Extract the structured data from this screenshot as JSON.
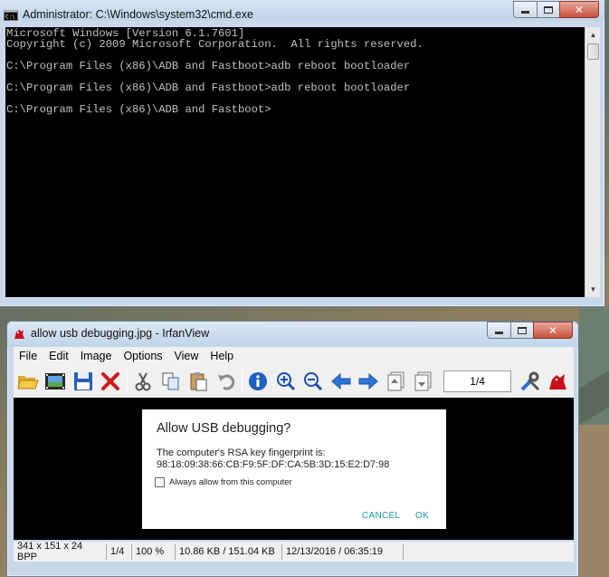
{
  "cmd": {
    "title": "Administrator: C:\\Windows\\system32\\cmd.exe",
    "lines": [
      "Microsoft Windows [Version 6.1.7601]",
      "Copyright (c) 2009 Microsoft Corporation.  All rights reserved.",
      "",
      "C:\\Program Files (x86)\\ADB and Fastboot>adb reboot bootloader",
      "",
      "C:\\Program Files (x86)\\ADB and Fastboot>adb reboot bootloader",
      "",
      "C:\\Program Files (x86)\\ADB and Fastboot>"
    ]
  },
  "irfanview": {
    "title": "allow usb debugging.jpg - IrfanView",
    "menu": [
      "File",
      "Edit",
      "Image",
      "Options",
      "View",
      "Help"
    ],
    "page_indicator": "1/4",
    "toolbar_icons": [
      "open-folder-icon",
      "thumbnails-icon",
      "save-icon",
      "delete-icon",
      "cut-icon",
      "copy-icon",
      "paste-icon",
      "undo-icon",
      "info-icon",
      "zoom-in-icon",
      "zoom-out-icon",
      "previous-icon",
      "next-icon",
      "previous-page-icon",
      "next-page-icon",
      "settings-icon",
      "irfan-cat-icon"
    ],
    "dialog": {
      "title": "Allow USB debugging?",
      "message_line1": "The computer's RSA key fingerprint is:",
      "message_line2": "98:18:09:38:66:CB:F9:5F:DF:CA:5B:3D:15:E2:D7:98",
      "checkbox_label": "Always allow from this computer",
      "checkbox_checked": false,
      "cancel_label": "CANCEL",
      "ok_label": "OK",
      "button_color": "#13a29b"
    },
    "status": {
      "dimensions": "341 x 151 x 24 BPP",
      "page": "1/4",
      "zoom": "100 %",
      "size": "10.86 KB / 151.04 KB",
      "datetime": "12/13/2016 / 06:35:19"
    }
  }
}
